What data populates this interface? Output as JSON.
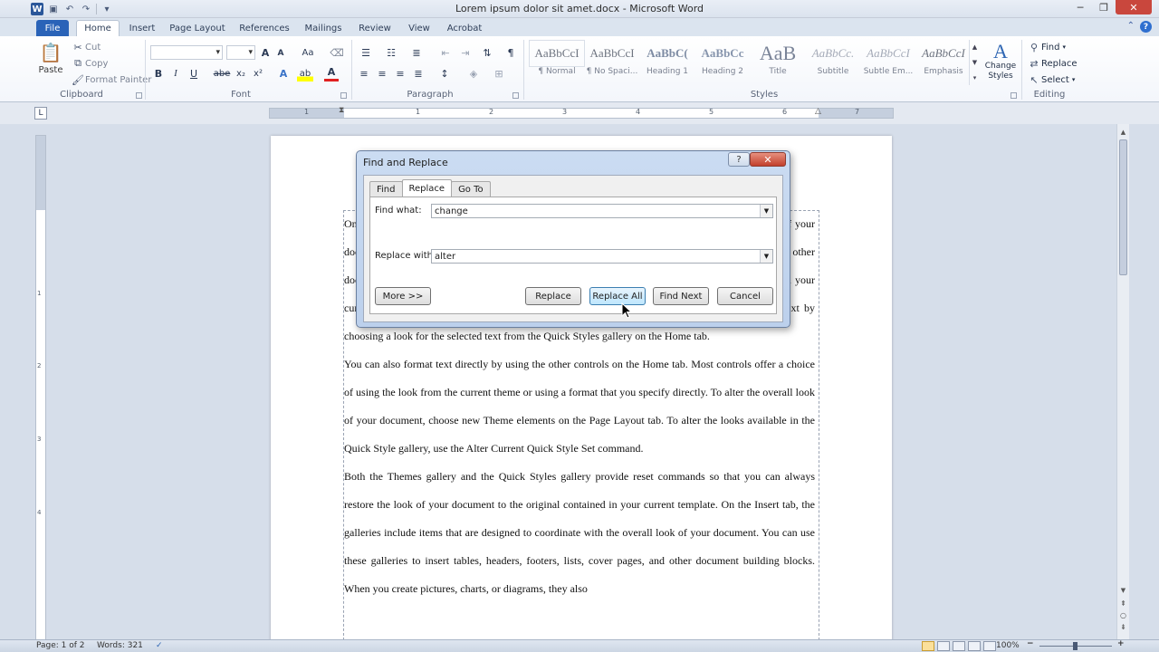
{
  "window": {
    "title": "Lorem ipsum dolor sit amet.docx - Microsoft Word",
    "app_letter": "W",
    "controls": {
      "minimize": "─",
      "restore": "❐",
      "close": "✕"
    }
  },
  "ribbon_tabs": [
    "File",
    "Home",
    "Insert",
    "Page Layout",
    "References",
    "Mailings",
    "Review",
    "View",
    "Acrobat"
  ],
  "clipboard": {
    "paste": "Paste",
    "cut": "Cut",
    "copy": "Copy",
    "format_painter": "Format Painter",
    "label": "Clipboard"
  },
  "font": {
    "label": "Font",
    "bold": "B",
    "italic": "I",
    "underline": "U",
    "strike": "abe",
    "sub": "x₂",
    "sup": "x²",
    "grow": "A",
    "shrink": "A",
    "case": "Aa"
  },
  "paragraph": {
    "label": "Paragraph"
  },
  "styles": {
    "label": "Styles",
    "items": [
      {
        "sample": "AaBbCcI",
        "name": "¶ Normal"
      },
      {
        "sample": "AaBbCcI",
        "name": "¶ No Spaci..."
      },
      {
        "sample": "AaBbC(",
        "name": "Heading 1"
      },
      {
        "sample": "AaBbCc",
        "name": "Heading 2"
      },
      {
        "sample": "AaB",
        "name": "Title"
      },
      {
        "sample": "AaBbCc.",
        "name": "Subtitle"
      },
      {
        "sample": "AaBbCcI",
        "name": "Subtle Em..."
      },
      {
        "sample": "AaBbCcI",
        "name": "Emphasis"
      }
    ],
    "change_styles": "Change Styles"
  },
  "editing": {
    "label": "Editing",
    "find": "Find",
    "replace": "Replace",
    "select": "Select"
  },
  "ruler": {
    "numbers": [
      "1",
      "1",
      "2",
      "3",
      "4",
      "5",
      "6",
      "7"
    ]
  },
  "vruler": {
    "numbers": [
      "1",
      "2",
      "3",
      "4"
    ]
  },
  "document": {
    "paragraphs": [
      "On the Insert tab, the galleries include items that are designed to coordinate with the overall look of your document. You can use these galleries to insert tables, headers, footers, lists, cover pages, and other document building blocks. When you create pictures, charts, or diagrams, they also coordinate with your current document look. You can easily change the formatting of selected text in the document text by choosing a look for the selected text from the Quick Styles gallery on the Home tab.",
      "You can also format text directly by using the other controls on the Home tab. Most controls offer a choice of using the look from the current theme or using a format that you specify directly. To alter the overall look of your document, choose new Theme elements on the Page Layout tab. To alter the looks available in the Quick Style gallery, use the Alter Current Quick Style Set command.",
      "Both the Themes gallery and the Quick Styles gallery provide reset commands so that you can always restore the look of your document to the original  contained in your current template. On the Insert tab, the galleries  include items that are designed to coordinate with the overall look of your document. You can use these galleries  to insert tables, headers, footers, lists, cover pages, and other document building blocks. When you create pictures, charts, or diagrams, they also"
    ]
  },
  "dialog": {
    "title": "Find and Replace",
    "help": "?",
    "close": "✕",
    "tabs": [
      "Find",
      "Replace",
      "Go To"
    ],
    "active_tab": "Replace",
    "find_label": "Find what:",
    "find_value": "change",
    "replace_label": "Replace with:",
    "replace_value": "alter",
    "buttons": {
      "more": "More >>",
      "replace": "Replace",
      "replace_all": "Replace All",
      "find_next": "Find Next",
      "cancel": "Cancel"
    }
  },
  "status": {
    "page": "Page: 1 of 2",
    "words": "Words: 321",
    "zoom": "100%"
  }
}
